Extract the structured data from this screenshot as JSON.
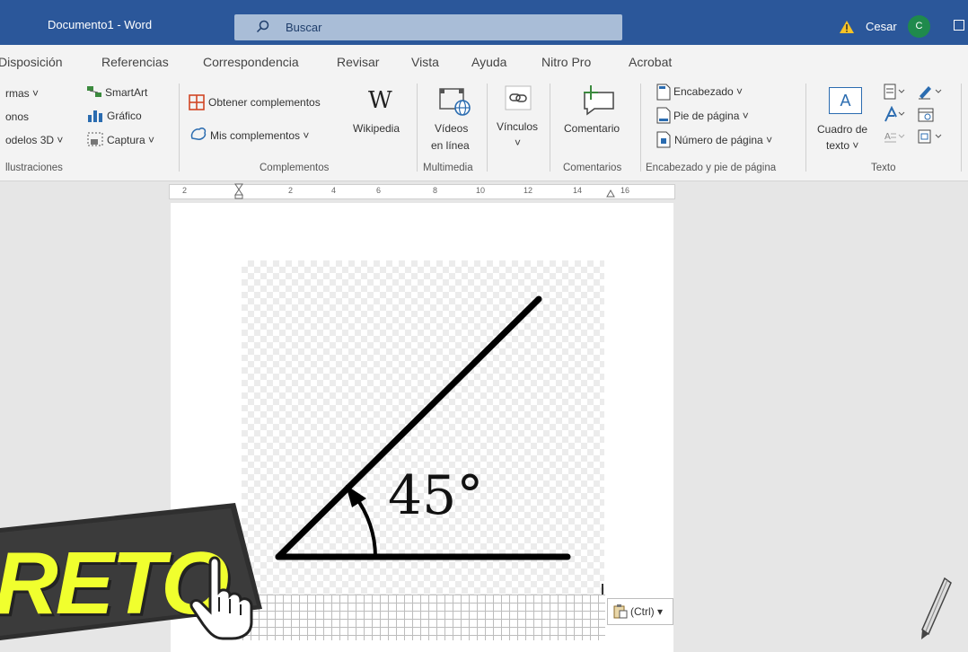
{
  "titlebar": {
    "doc_title": "Documento1  -  Word",
    "search_label": "Buscar",
    "user": "Cesar",
    "avatar_initial": "C"
  },
  "tabs": [
    "Disposición",
    "Referencias",
    "Correspondencia",
    "Revisar",
    "Vista",
    "Ayuda",
    "Nitro Pro",
    "Acrobat"
  ],
  "ribbon": {
    "illustrations": {
      "formas": "rmas ˅",
      "iconos": "onos",
      "modelos3d": "odelos 3D  ˅",
      "smartart": "SmartArt",
      "grafico": "Gráfico",
      "captura": "Captura ˅",
      "group": "llustraciones"
    },
    "complementos": {
      "obtener": "Obtener complementos",
      "mis": "Mis complementos  ˅",
      "wikipedia_glyph": "W",
      "wikipedia": "Wikipedia",
      "group": "Complementos"
    },
    "multimedia": {
      "videos_1": "Vídeos",
      "videos_2": "en línea",
      "group": "Multimedia"
    },
    "vinculos": {
      "label": "Vínculos",
      "chevron": "˅"
    },
    "comentarios": {
      "label": "Comentario",
      "group": "Comentarios"
    },
    "encabezado": {
      "encabezado": "Encabezado ˅",
      "pie": "Pie de página ˅",
      "numero": "Número de página ˅",
      "group": "Encabezado y pie de página"
    },
    "texto": {
      "cuadro_1": "Cuadro de",
      "cuadro_2": "texto ˅",
      "box_glyph": "A",
      "group": "Texto"
    }
  },
  "ruler": [
    "2",
    "2",
    "4",
    "6",
    "8",
    "10",
    "12",
    "14",
    "16"
  ],
  "figure": {
    "angle_label": "45°"
  },
  "paste_options": {
    "label": "(Ctrl) ▾"
  },
  "overlay": {
    "reto": "RETO"
  },
  "colors": {
    "title_blue": "#2b579a",
    "reto_yellow": "#f0ff2e",
    "avatar_green": "#1f8a4c"
  }
}
